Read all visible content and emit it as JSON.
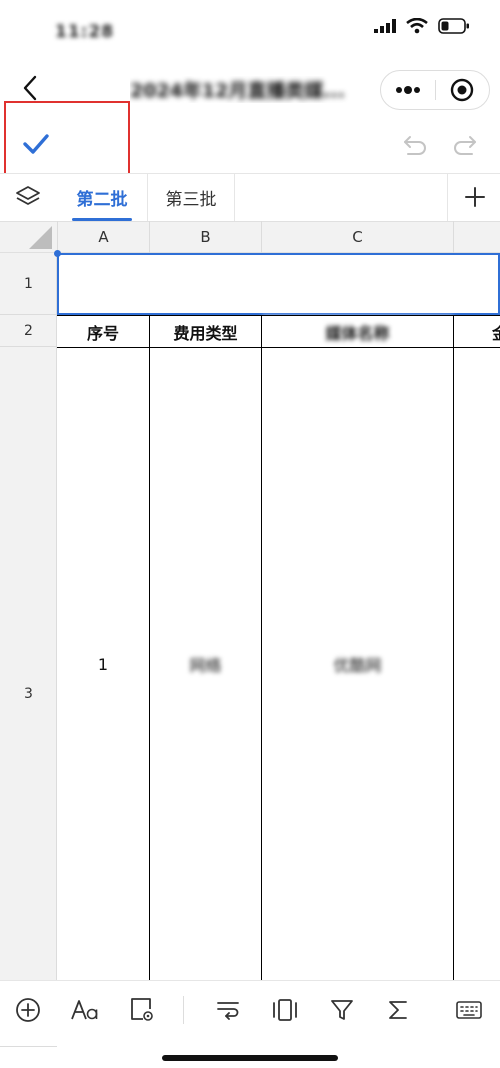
{
  "status_bar": {
    "time": "11:28"
  },
  "nav": {
    "title": "2024年12月直播类媒..."
  },
  "sheet_tabs": [
    {
      "label": "第二批",
      "active": true
    },
    {
      "label": "第三批",
      "active": false
    }
  ],
  "columns": [
    "A",
    "B",
    "C"
  ],
  "rows": [
    "1",
    "2",
    "3"
  ],
  "table": {
    "headers": [
      "序号",
      "费用类型",
      "媒体名称",
      "金"
    ],
    "row3": [
      "1",
      "网络",
      "优酷网"
    ]
  },
  "colors": {
    "accent": "#2f6fd6",
    "highlight_box": "#e0312f",
    "header_bg": "#f2f2f2"
  },
  "icons": {
    "toolbar": [
      "check-icon",
      "undo-icon",
      "redo-icon"
    ],
    "bottom": [
      "insert-circle-icon",
      "text-format-icon",
      "cell-style-icon",
      "wrap-text-icon",
      "freeze-icon",
      "filter-icon",
      "sum-icon",
      "keyboard-icon"
    ]
  }
}
